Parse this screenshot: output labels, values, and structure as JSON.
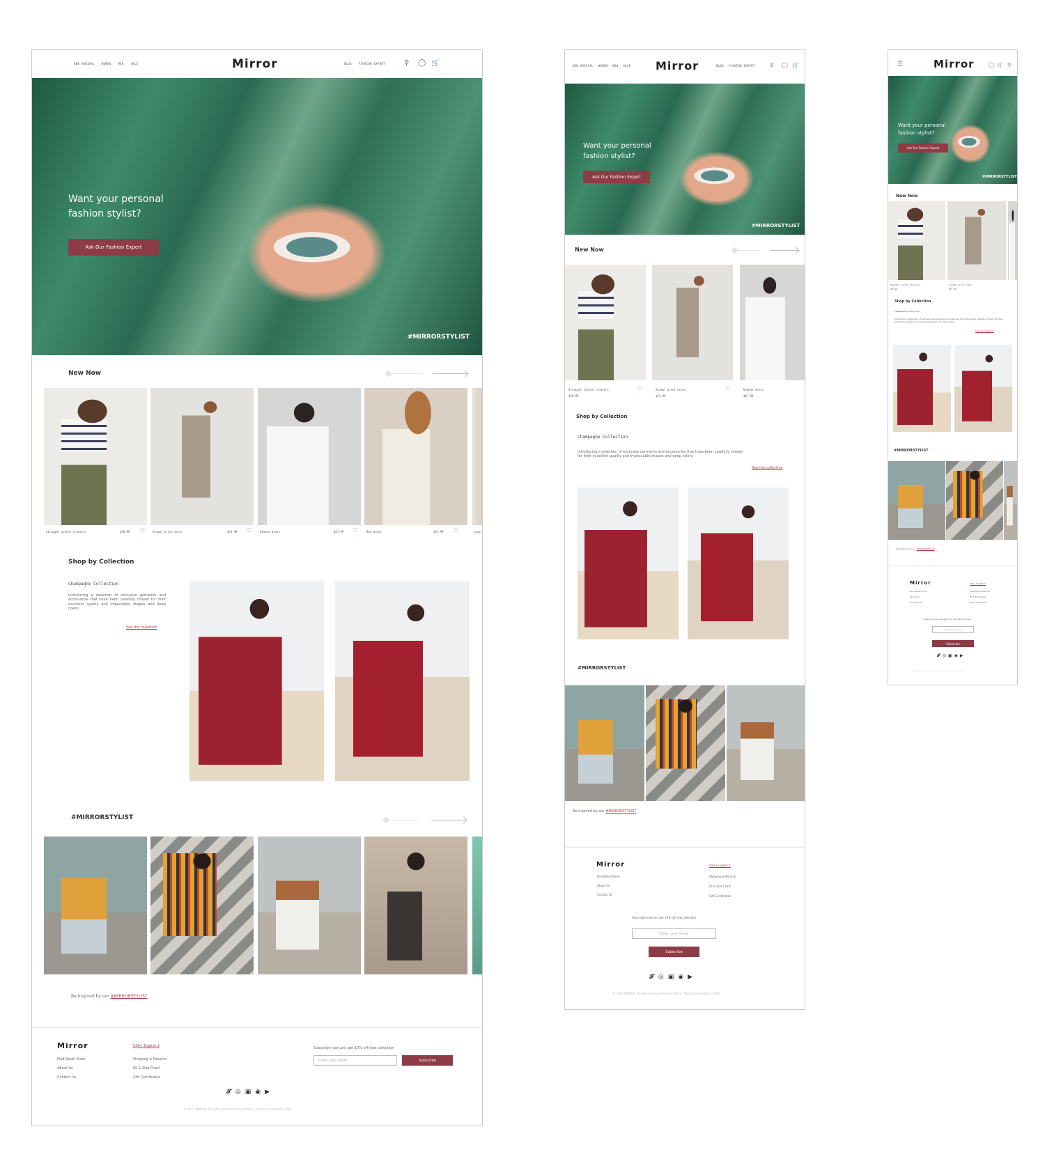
{
  "brand": {
    "logo": "Mirror",
    "accent_color": "#b53a46",
    "button_color": "#8d3c45"
  },
  "nav": {
    "left": [
      "NEW ARRIVAL",
      "WOMEN",
      "MEN",
      "SALE"
    ],
    "right": [
      "BLOG",
      "FASHION EXPERT"
    ],
    "icons": [
      "search-icon",
      "user-icon",
      "cart-icon",
      "menu-icon"
    ]
  },
  "hero": {
    "title_line1": "Want your personal",
    "title_line2": "fashion stylist?",
    "cta": "Ask Our Fashion Expert",
    "hashtag": "#MIRRORSTYLIST"
  },
  "new_now": {
    "title": "New Now",
    "products": [
      {
        "name": "Straight cotton trousers",
        "price": "$39.99"
      },
      {
        "name": "Animal print dress",
        "price": "$21.99"
      },
      {
        "name": "Kimono dress",
        "price": "$67.99"
      },
      {
        "name": "Bow dress",
        "price": "$37.99"
      },
      {
        "name": "Long"
      }
    ]
  },
  "collection": {
    "title": "Shop by Collection",
    "name": "Champagne Collection",
    "description": "Introducing a selection of exclusive garments and accessories that have been carefully chosen for their excellent quality and impeccable shapes and deep colors.",
    "link": "See the collection"
  },
  "stylist": {
    "title": "#MIRRORSTYLIST",
    "inspired_prefix": "Be inspired by our",
    "inspired_link": "#MIRRORSTYLIST"
  },
  "footer": {
    "logo": "Mirror",
    "links_left": [
      "Find Retail Store",
      "About Us",
      "Contact Us"
    ],
    "locale": "USA | English $",
    "links_right": [
      "Shipping & Returns",
      "Fit & Size Chart",
      "Gift Certificates"
    ],
    "subscribe_text": "Subscribe now and get 10% off new collection",
    "email_placeholder": "Enter your email",
    "subscribe_button": "Subscribe",
    "social_icons": [
      "twitter-icon",
      "instagram-icon",
      "facebook-icon",
      "pinterest-icon",
      "youtube-icon"
    ],
    "copyright": "© 2019 MIRROR All rights reserved Privacy Policy | Terms & Conditions | ADA"
  }
}
